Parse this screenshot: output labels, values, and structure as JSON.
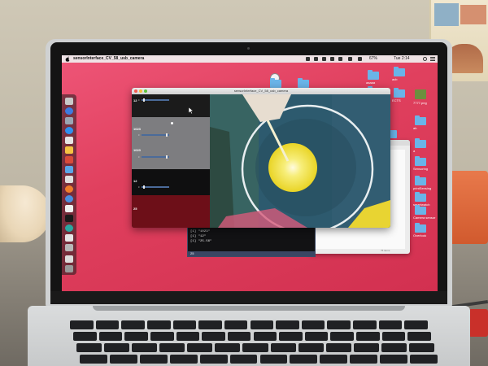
{
  "menubar": {
    "app_title": "sensorInterface_CV_58_usb_camera",
    "battery": "67%",
    "clock": "Tue 2:14"
  },
  "app_window": {
    "title": "sensorInterface_CV_58_usb_camera"
  },
  "controls": [
    {
      "value": "12",
      "slider_min": "0",
      "slider_level": 0.05
    },
    {
      "value": "1023",
      "slider_min": "0",
      "slider_level": 0.95
    },
    {
      "value": "1023",
      "slider_min": "0",
      "slider_level": 0.95
    },
    {
      "value": "12",
      "slider_min": "0",
      "slider_level": 0.05
    },
    {
      "value": "25",
      "slider_min": "",
      "slider_level": null
    }
  ],
  "terminal": {
    "lines": [
      "[1] \"1023\"",
      "[1] \"12\"",
      "[1] \"25.56\""
    ],
    "footer": "25"
  },
  "desktop": {
    "folders": [
      {
        "label": "aaaaa"
      },
      {
        "label": "acb"
      },
      {
        "label": "cd"
      },
      {
        "label": "a"
      },
      {
        "label": "ECB"
      },
      {
        "label": "ECTS"
      },
      {
        "label": "ab"
      },
      {
        "label": "ab"
      },
      {
        "label": "a"
      },
      {
        "label": "Sensoring"
      },
      {
        "label": "printSensing"
      },
      {
        "label": "smartwatch"
      },
      {
        "label": "Camera sensor"
      },
      {
        "label": "Overlook"
      }
    ],
    "image_label": "7777.png"
  },
  "finder": {
    "status": "75 items"
  },
  "colors": {
    "desktop": "#e0405e",
    "panel_strip_dark": "#1b1b1b",
    "panel_strip_gray": "#7d7d80",
    "panel_strip_red": "#6d0f18",
    "slider": "#4b6b9a",
    "yellow_target": "#e9d425",
    "camera_teal": "#2d5a6e"
  }
}
